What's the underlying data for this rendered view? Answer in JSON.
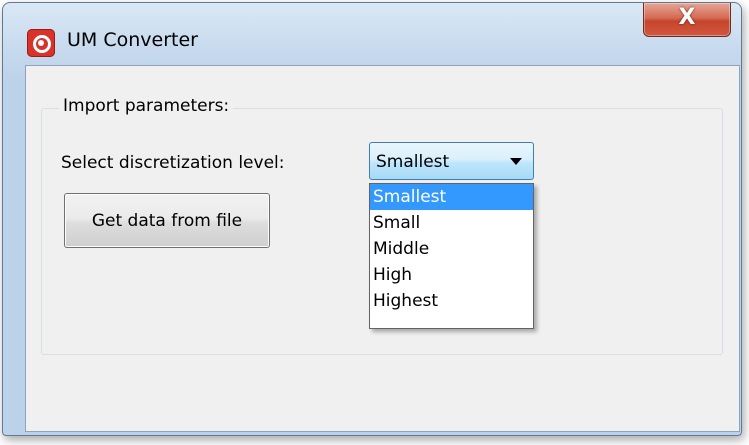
{
  "window": {
    "title": "UM Converter",
    "close_glyph": "X",
    "app_icon": "um-app-icon"
  },
  "group": {
    "title": "Import parameters:"
  },
  "discretization": {
    "label": "Select discretization level:",
    "selected": "Smallest",
    "options": [
      "Smallest",
      "Small",
      "Middle",
      "High",
      "Highest"
    ],
    "highlighted_index": 0
  },
  "buttons": {
    "get_data": "Get data from file"
  },
  "colors": {
    "selection_highlight": "#3399ff",
    "client_background": "#f0f0f0",
    "close_button": "#c5452c",
    "app_icon": "#d8322a"
  }
}
